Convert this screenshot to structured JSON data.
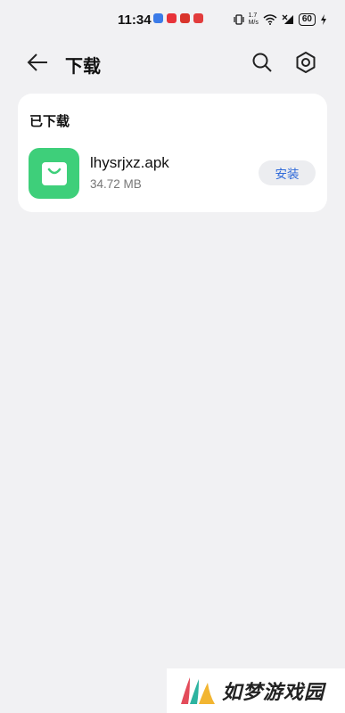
{
  "status_bar": {
    "time": "11:34",
    "net_speed_value": "1.7",
    "net_speed_unit": "M/s",
    "battery": "60"
  },
  "header": {
    "title": "下载"
  },
  "downloaded_section": {
    "title": "已下载",
    "items": [
      {
        "file_name": "lhysrjxz.apk",
        "file_size": "34.72 MB",
        "action_label": "安装"
      }
    ]
  },
  "watermark": {
    "text": "如梦游戏园"
  },
  "colors": {
    "background": "#f1f1f3",
    "app_icon_green": "#3ecf7a",
    "install_text_blue": "#2f6ad9"
  }
}
